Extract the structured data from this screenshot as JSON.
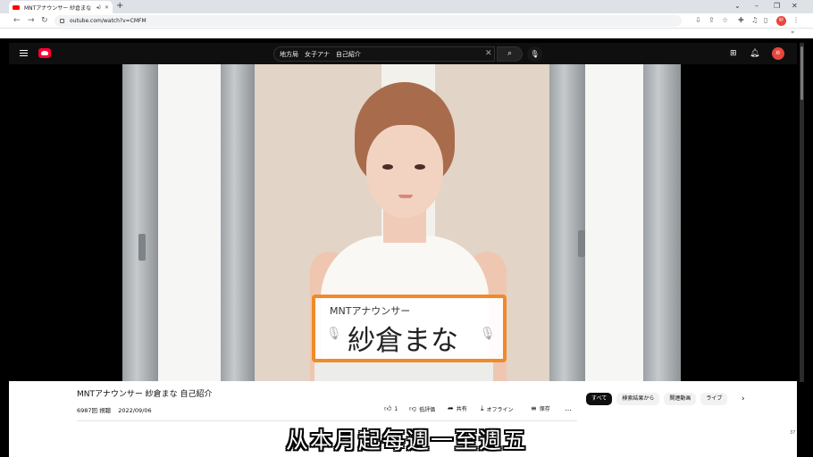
{
  "browser": {
    "tab_title": "MNTアナウンサー 紗倉まな",
    "url": "outube.com/watch?v=CMFM",
    "profile_initial": "紗"
  },
  "youtube": {
    "search_value": "地方局　女子アナ　自己紹介",
    "avatar_initial": "紗"
  },
  "video": {
    "caption_sub": "MNTアナウンサー",
    "caption_name": "紗倉まな",
    "title": "MNTアナウンサー 紗倉まな 自己紹介",
    "views": "6987回 視聴",
    "date": "2022/09/06",
    "actions": {
      "like_count": "1",
      "dislike_label": "低評価",
      "share_label": "共有",
      "offline_label": "オフライン",
      "save_label": "保存",
      "more_label": "…"
    }
  },
  "chips": [
    "すべて",
    "検索結果から",
    "関連動画",
    "ライブ"
  ],
  "subtitle": "从本月起每週一至週五",
  "counter": "37",
  "colors": {
    "youtube_red": "#FF0033",
    "caption_border": "#F08A2B",
    "header_bg": "#0F0F0F"
  }
}
